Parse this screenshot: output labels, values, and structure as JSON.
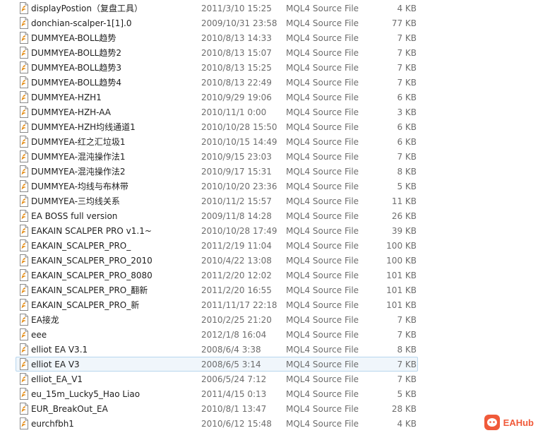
{
  "file_list": {
    "selected_index": 24,
    "rows": [
      {
        "name": "displayPostion（复盘工具）",
        "date": "2011/3/10 15:25",
        "type": "MQL4 Source File",
        "size": "4 KB"
      },
      {
        "name": "donchian-scalper-1[1].0",
        "date": "2009/10/31 23:58",
        "type": "MQL4 Source File",
        "size": "77 KB"
      },
      {
        "name": "DUMMYEA-BOLL趋势",
        "date": "2010/8/13 14:33",
        "type": "MQL4 Source File",
        "size": "7 KB"
      },
      {
        "name": "DUMMYEA-BOLL趋势2",
        "date": "2010/8/13 15:07",
        "type": "MQL4 Source File",
        "size": "7 KB"
      },
      {
        "name": "DUMMYEA-BOLL趋势3",
        "date": "2010/8/13 15:25",
        "type": "MQL4 Source File",
        "size": "7 KB"
      },
      {
        "name": "DUMMYEA-BOLL趋势4",
        "date": "2010/8/13 22:49",
        "type": "MQL4 Source File",
        "size": "7 KB"
      },
      {
        "name": "DUMMYEA-HZH1",
        "date": "2010/9/29 19:06",
        "type": "MQL4 Source File",
        "size": "6 KB"
      },
      {
        "name": "DUMMYEA-HZH-AA",
        "date": "2010/11/1 0:00",
        "type": "MQL4 Source File",
        "size": "3 KB"
      },
      {
        "name": "DUMMYEA-HZH均线通道1",
        "date": "2010/10/28 15:50",
        "type": "MQL4 Source File",
        "size": "6 KB"
      },
      {
        "name": "DUMMYEA-红之汇垃圾1",
        "date": "2010/10/15 14:49",
        "type": "MQL4 Source File",
        "size": "6 KB"
      },
      {
        "name": "DUMMYEA-混沌操作法1",
        "date": "2010/9/15 23:03",
        "type": "MQL4 Source File",
        "size": "7 KB"
      },
      {
        "name": "DUMMYEA-混沌操作法2",
        "date": "2010/9/17 15:31",
        "type": "MQL4 Source File",
        "size": "8 KB"
      },
      {
        "name": "DUMMYEA-均线与布林带",
        "date": "2010/10/20 23:36",
        "type": "MQL4 Source File",
        "size": "5 KB"
      },
      {
        "name": "DUMMYEA-三均线关系",
        "date": "2010/11/2 15:57",
        "type": "MQL4 Source File",
        "size": "11 KB"
      },
      {
        "name": "EA BOSS full version",
        "date": "2009/11/8 14:28",
        "type": "MQL4 Source File",
        "size": "26 KB"
      },
      {
        "name": "EAKAIN SCALPER PRO v1.1~",
        "date": "2010/10/28 17:49",
        "type": "MQL4 Source File",
        "size": "39 KB"
      },
      {
        "name": "EAKAIN_SCALPER_PRO_",
        "date": "2011/2/19 11:04",
        "type": "MQL4 Source File",
        "size": "100 KB"
      },
      {
        "name": "EAKAIN_SCALPER_PRO_2010",
        "date": "2010/4/22 13:08",
        "type": "MQL4 Source File",
        "size": "100 KB"
      },
      {
        "name": "EAKAIN_SCALPER_PRO_8080",
        "date": "2011/2/20 12:02",
        "type": "MQL4 Source File",
        "size": "101 KB"
      },
      {
        "name": "EAKAIN_SCALPER_PRO_翻新",
        "date": "2011/2/20 16:55",
        "type": "MQL4 Source File",
        "size": "101 KB"
      },
      {
        "name": "EAKAIN_SCALPER_PRO_新",
        "date": "2011/11/17 22:18",
        "type": "MQL4 Source File",
        "size": "101 KB"
      },
      {
        "name": "EA接龙",
        "date": "2010/2/25 21:20",
        "type": "MQL4 Source File",
        "size": "7 KB"
      },
      {
        "name": "eee",
        "date": "2012/1/8 16:04",
        "type": "MQL4 Source File",
        "size": "7 KB"
      },
      {
        "name": "elliot EA V3.1",
        "date": "2008/6/4 3:38",
        "type": "MQL4 Source File",
        "size": "8 KB"
      },
      {
        "name": "elliot EA V3",
        "date": "2008/6/5 3:14",
        "type": "MQL4 Source File",
        "size": "7 KB"
      },
      {
        "name": "elliot_EA_V1",
        "date": "2006/5/24 7:12",
        "type": "MQL4 Source File",
        "size": "7 KB"
      },
      {
        "name": "eu_15m_Lucky5_Hao Liao",
        "date": "2011/4/15 0:13",
        "type": "MQL4 Source File",
        "size": "5 KB"
      },
      {
        "name": "EUR_BreakOut_EA",
        "date": "2010/8/1 13:47",
        "type": "MQL4 Source File",
        "size": "28 KB"
      },
      {
        "name": "eurchfbh1",
        "date": "2010/6/12 15:48",
        "type": "MQL4 Source File",
        "size": "4 KB"
      }
    ]
  },
  "watermark": {
    "text": "EAHub",
    "icon": "eahub-logo-icon",
    "color": "#f05a3a"
  },
  "colors": {
    "selection_bg": "#f0f6fb",
    "selection_border": "#b8d6ee",
    "icon_accent": "#e48a10"
  }
}
